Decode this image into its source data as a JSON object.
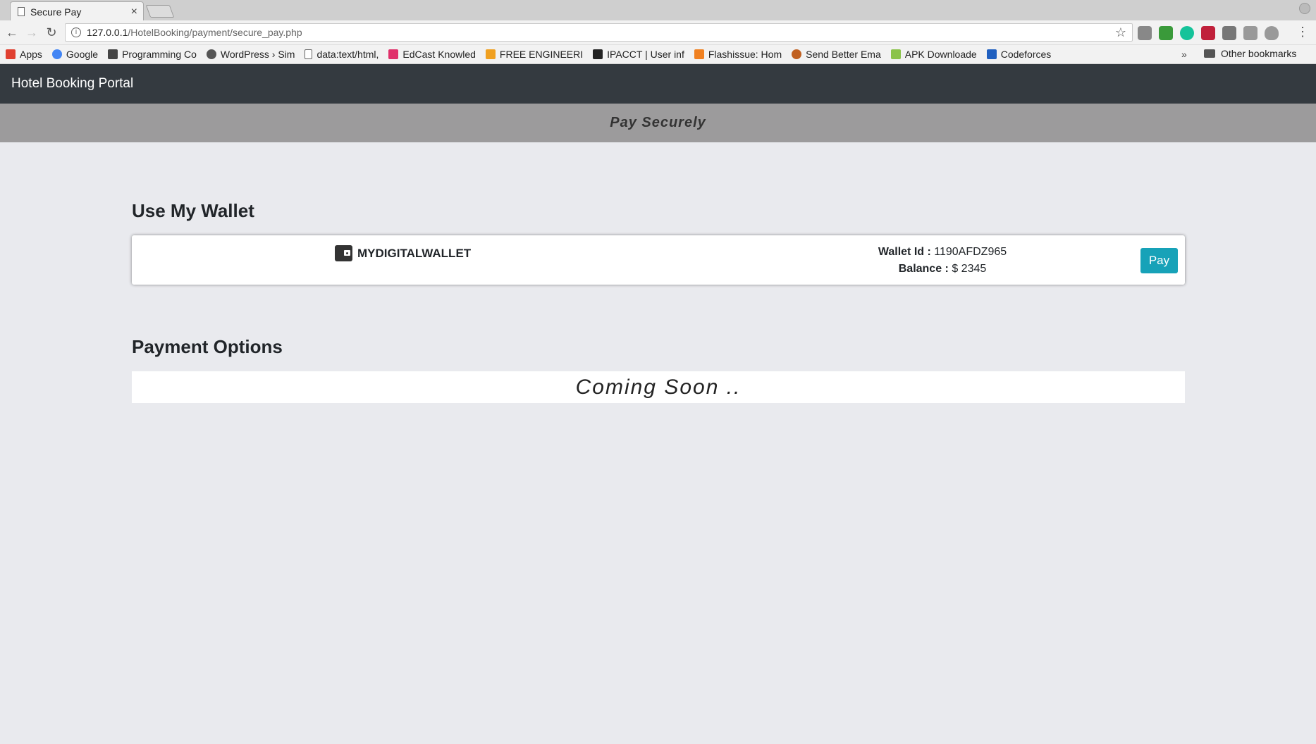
{
  "browser": {
    "tab_title": "Secure Pay",
    "tab_close": "×",
    "url_host": "127.0.0.1",
    "url_path": "/HotelBooking/payment/secure_pay.php",
    "bookmarks": [
      {
        "label": "Apps",
        "icon": "apps-grid-icon",
        "color": "#e04030"
      },
      {
        "label": "Google",
        "icon": "google-icon",
        "color": "#4285f4"
      },
      {
        "label": "Programming Co",
        "icon": "cc-icon",
        "color": "#444444"
      },
      {
        "label": "WordPress › Sim",
        "icon": "wordpress-icon",
        "color": "#555555"
      },
      {
        "label": "data:text/html,",
        "icon": "page-icon",
        "color": "#ffffff"
      },
      {
        "label": "EdCast Knowled",
        "icon": "edcast-icon",
        "color": "#e0306a"
      },
      {
        "label": "FREE ENGINEERI",
        "icon": "triangle-icon",
        "color": "#f0a020"
      },
      {
        "label": "IPACCT | User inf",
        "icon": "ipacct-icon",
        "color": "#222222"
      },
      {
        "label": "Flashissue: Hom",
        "icon": "flashissue-icon",
        "color": "#f08020"
      },
      {
        "label": "Send Better Ema",
        "icon": "send-icon",
        "color": "#c06020"
      },
      {
        "label": "APK Downloade",
        "icon": "apk-icon",
        "color": "#8bc34a"
      },
      {
        "label": "Codeforces",
        "icon": "codeforces-icon",
        "color": "#2060c0"
      }
    ],
    "more": "»",
    "other_bookmarks": "Other bookmarks"
  },
  "navbar": {
    "brand": "Hotel Booking Portal"
  },
  "subheader": {
    "title": "Pay Securely"
  },
  "wallet_section": {
    "heading": "Use My Wallet",
    "wallet_name": "MYDIGITALWALLET",
    "wallet_id_label": "Wallet Id :",
    "wallet_id": "1190AFDZ965",
    "balance_label": "Balance :",
    "balance": "$ 2345",
    "pay_label": "Pay"
  },
  "payment_section": {
    "heading": "Payment Options",
    "coming_soon": "Coming Soon .."
  }
}
